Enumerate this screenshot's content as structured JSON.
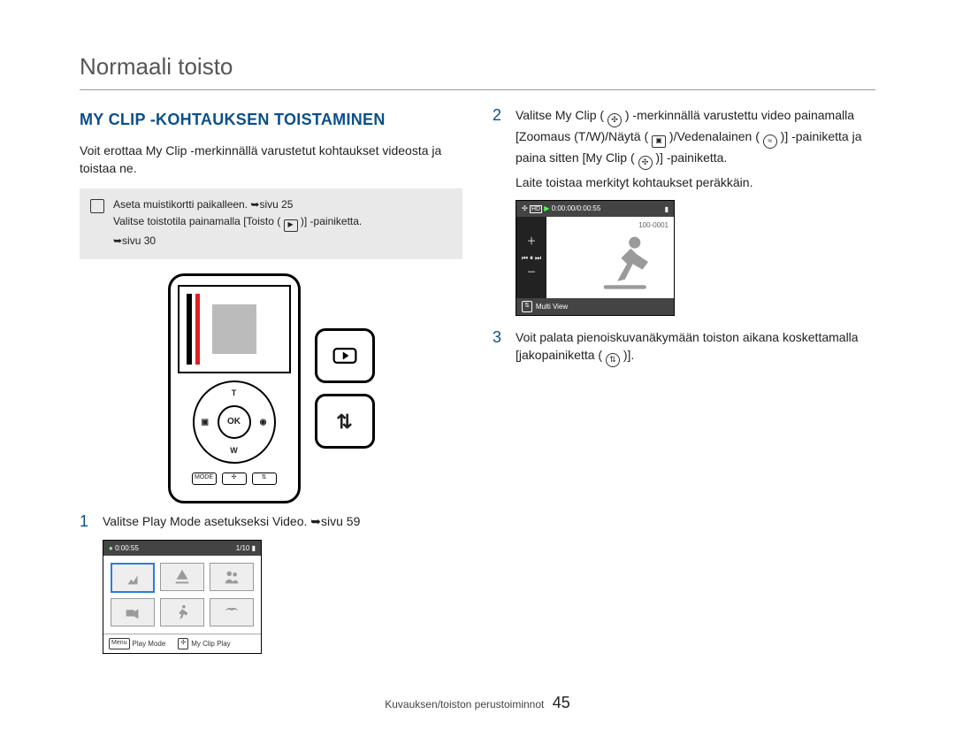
{
  "page_title": "Normaali toisto",
  "section_heading": "MY CLIP -KOHTAUKSEN TOISTAMINEN",
  "intro": "Voit erottaa My Clip -merkinnällä varustetut kohtaukset videosta ja toistaa ne.",
  "note": {
    "line1": "Aseta muistikortti paikalleen. ➥sivu 25",
    "line2_a": "Valitse toistotila painamalla [Toisto (",
    "line2_b": ")] -painiketta.",
    "line3": "➥sivu 30"
  },
  "device": {
    "ok": "OK",
    "t": "T",
    "w": "W",
    "left_icon": "▣",
    "right_icon": "◉"
  },
  "steps": {
    "s1": {
      "num": "1",
      "text_a": "Valitse Play Mode asetukseksi Video.",
      "text_b": "➥sivu 59",
      "lcd": {
        "top_left_time": "0:00:55",
        "top_right": "1/10",
        "footer_left_key": "Menu",
        "footer_left_label": "Play Mode",
        "footer_right_label": "My Clip Play"
      }
    },
    "s2": {
      "num": "2",
      "text_a": "Valitse My Clip (",
      "text_b": ") -merkinnällä varustettu video painamalla [Zoomaus (T/W)/Näytä (",
      "text_c": ")/Vedenalainen (",
      "text_d": ")] -painiketta ja paina sitten [My Clip (",
      "text_e": ")] -painiketta.",
      "sub": "Laite toistaa merkityt kohtaukset peräkkäin.",
      "lcd": {
        "top_time": "0:00:00/0:00:55",
        "file_no": "100-0001",
        "footer_label": "Multi View"
      }
    },
    "s3": {
      "num": "3",
      "text_a": "Voit palata pienoiskuvanäkymään toiston aikana koskettamalla [jakopainiketta (",
      "text_b": ")]."
    }
  },
  "footer": {
    "label": "Kuvauksen/toiston perustoiminnot",
    "page_no": "45"
  }
}
